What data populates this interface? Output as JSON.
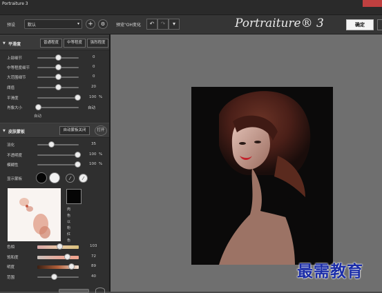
{
  "window": {
    "title": "Portraiture 3"
  },
  "toolbar": {
    "preset_label": "预设",
    "preset_value": "默认",
    "preview_label": "预览\"OH变化",
    "brand": "Portraiture® 3",
    "ok_label": "确定"
  },
  "smoothing": {
    "title": "平滑度",
    "buttons": [
      "普通程度",
      "中等程度",
      "强烈程度"
    ],
    "sliders": [
      {
        "label": "上部细节",
        "value": "0"
      },
      {
        "label": "中等程度细节",
        "value": "0"
      },
      {
        "label": "大范围细节",
        "value": "0"
      },
      {
        "label": "阈值",
        "value": "20"
      },
      {
        "label": "平滑度",
        "value": "100",
        "unit": "%"
      },
      {
        "label": "肖像大小",
        "value": "自动",
        "note": "自动"
      }
    ]
  },
  "skin_mask": {
    "title": "皮肤蒙板",
    "auto_button": "自动蒙板关闭",
    "toggle": "打开",
    "sliders": [
      {
        "label": "羽化",
        "value": "35"
      },
      {
        "label": "不透明度",
        "value": "100",
        "unit": "%"
      },
      {
        "label": "模糊性",
        "value": "100",
        "unit": "%"
      }
    ],
    "show_mask_label": "显示蒙板",
    "vertical_text": "肉色以粉红色",
    "hsl_sliders": [
      {
        "label": "色相",
        "value": "103"
      },
      {
        "label": "饱和度",
        "value": "72"
      },
      {
        "label": "明度",
        "value": "89"
      },
      {
        "label": "范围",
        "value": "40"
      }
    ],
    "colors": {
      "swatch_dark": "#050505",
      "swatch_light": "#f2f2f2",
      "mask_color": "#050505"
    }
  },
  "watermark": "最需教育"
}
